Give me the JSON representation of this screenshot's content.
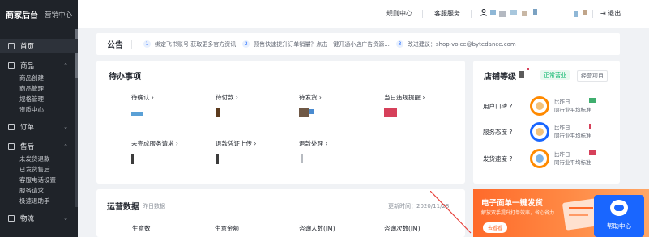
{
  "brand": {
    "title": "商家后台",
    "subtitle": "营销中心"
  },
  "sidebar": {
    "items": [
      {
        "label": "首页",
        "active": true,
        "icon": "home-icon"
      },
      {
        "label": "商品",
        "icon": "product-icon",
        "children": [
          "商品创建",
          "商品管理",
          "规格管理",
          "资质中心"
        ]
      },
      {
        "label": "订单",
        "icon": "order-icon"
      },
      {
        "label": "售后",
        "icon": "aftersale-icon",
        "children": [
          "未发货退款",
          "已发货售后",
          "客服电话设置",
          "服务请求",
          "极速退助手"
        ]
      },
      {
        "label": "物流",
        "icon": "logistics-icon"
      }
    ]
  },
  "topbar": {
    "links": [
      "规则中心",
      "客服服务"
    ],
    "logout": "退出"
  },
  "notice": {
    "title": "公告",
    "items": [
      {
        "num": "1",
        "text": "绑定飞书账号 获取更多官方资讯"
      },
      {
        "num": "2",
        "text": "预售快速提升订单销量？点击一键开通小店广告资源..."
      },
      {
        "num": "3",
        "text": "改进建议：shop-voice@bytedance.com"
      }
    ]
  },
  "todo": {
    "title": "待办事项",
    "items": [
      {
        "label": "待确认 ›"
      },
      {
        "label": "待付款 ›"
      },
      {
        "label": "待发货 ›"
      },
      {
        "label": "当日违规提醒 ›"
      },
      {
        "label": "未完成服务请求 ›"
      },
      {
        "label": "退款凭证上传 ›"
      },
      {
        "label": "退款处理 ›"
      }
    ]
  },
  "store": {
    "title": "店铺等级",
    "badge_active": "正常营业",
    "badge_link": "经营项目",
    "metrics": [
      {
        "label": "用户口碑 ?",
        "l1": "比昨日",
        "l2": "同行业平均标准"
      },
      {
        "label": "服务态度 ?",
        "l1": "比昨日",
        "l2": "同行业平均标准"
      },
      {
        "label": "发货速度 ?",
        "l1": "比昨日",
        "l2": "同行业平均标准"
      }
    ]
  },
  "ops": {
    "title": "运营数据",
    "subtitle": "昨日数据",
    "update_time": "更新时间：2020/11/28",
    "columns": [
      "生意数",
      "生意金额",
      "咨询人数(IM)",
      "咨询次数(IM)"
    ]
  },
  "banner": {
    "title": "电子面单一键发货",
    "subtitle": "解放双手提升打单效率，省心省力",
    "button": "去看看"
  },
  "help": {
    "label": "帮助中心"
  },
  "colors": {
    "accent": "#1966ff",
    "sidebar_bg": "#1f2329",
    "banner": "#ff6a2a",
    "success": "#00b365"
  }
}
